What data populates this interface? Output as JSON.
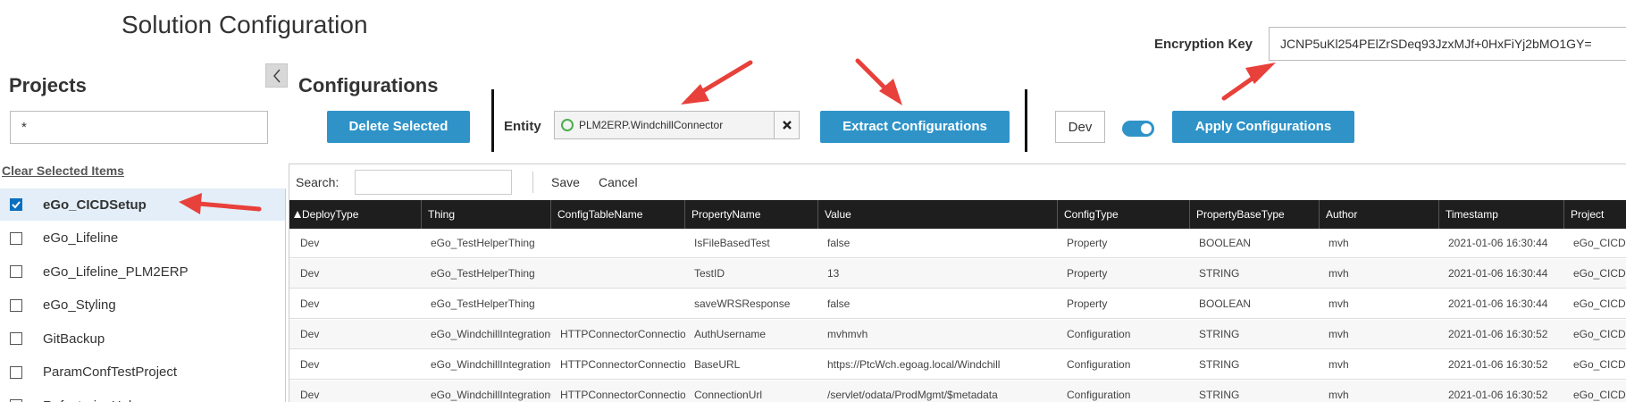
{
  "page_title": "Solution Configuration",
  "encryption": {
    "label": "Encryption Key",
    "value": "JCNP5uKl254PElZrSDeq93JzxMJf+0HxFiYj2bMO1GY="
  },
  "projects": {
    "title": "Projects",
    "filter_value": "*",
    "clear_label": "Clear Selected Items",
    "items": [
      {
        "label": "eGo_CICDSetup",
        "checked": true
      },
      {
        "label": "eGo_Lifeline",
        "checked": false
      },
      {
        "label": "eGo_Lifeline_PLM2ERP",
        "checked": false
      },
      {
        "label": "eGo_Styling",
        "checked": false
      },
      {
        "label": "GitBackup",
        "checked": false
      },
      {
        "label": "ParamConfTestProject",
        "checked": false
      },
      {
        "label": "RefactoringHelper",
        "checked": false
      }
    ]
  },
  "configurations": {
    "title": "Configurations",
    "delete_label": "Delete Selected",
    "entity_label": "Entity",
    "entity_value": "PLM2ERP.WindchillConnector",
    "extract_label": "Extract Configurations",
    "env_value": "Dev",
    "apply_label": "Apply Configurations"
  },
  "grid": {
    "search_label": "Search:",
    "save_label": "Save",
    "cancel_label": "Cancel",
    "columns": [
      "DeployType",
      "Thing",
      "ConfigTableName",
      "PropertyName",
      "Value",
      "ConfigType",
      "PropertyBaseType",
      "Author",
      "Timestamp",
      "Project"
    ],
    "rows": [
      [
        "Dev",
        "eGo_TestHelperThing",
        "",
        "IsFileBasedTest",
        "false",
        "Property",
        "BOOLEAN",
        "mvh",
        "2021-01-06 16:30:44",
        "eGo_CICDSetup"
      ],
      [
        "Dev",
        "eGo_TestHelperThing",
        "",
        "TestID",
        "13",
        "Property",
        "STRING",
        "mvh",
        "2021-01-06 16:30:44",
        "eGo_CICDSetup"
      ],
      [
        "Dev",
        "eGo_TestHelperThing",
        "",
        "saveWRSResponse",
        "false",
        "Property",
        "BOOLEAN",
        "mvh",
        "2021-01-06 16:30:44",
        "eGo_CICDSetup"
      ],
      [
        "Dev",
        "eGo_WindchillIntegrationConnector",
        "HTTPConnectorConnection",
        "AuthUsername",
        "mvhmvh",
        "Configuration",
        "STRING",
        "mvh",
        "2021-01-06 16:30:52",
        "eGo_CICDSetup"
      ],
      [
        "Dev",
        "eGo_WindchillIntegrationConnector",
        "HTTPConnectorConnection",
        "BaseURL",
        "https://PtcWch.egoag.local/Windchill",
        "Configuration",
        "STRING",
        "mvh",
        "2021-01-06 16:30:52",
        "eGo_CICDSetup"
      ],
      [
        "Dev",
        "eGo_WindchillIntegrationConnector",
        "HTTPConnectorConnection",
        "ConnectionUrl",
        "/servlet/odata/ProdMgmt/$metadata",
        "Configuration",
        "STRING",
        "mvh",
        "2021-01-06 16:30:52",
        "eGo_CICDSetup"
      ]
    ]
  },
  "icons": {
    "collapse": "chevron-left-icon",
    "entity": "thing-shape-icon",
    "clear": "close-icon",
    "sort": "sort-asc-icon"
  },
  "colors": {
    "accent": "#2f93c8",
    "header_bg": "#1e1e1e",
    "selection": "#e3eef8",
    "annotation": "#e8403a"
  }
}
